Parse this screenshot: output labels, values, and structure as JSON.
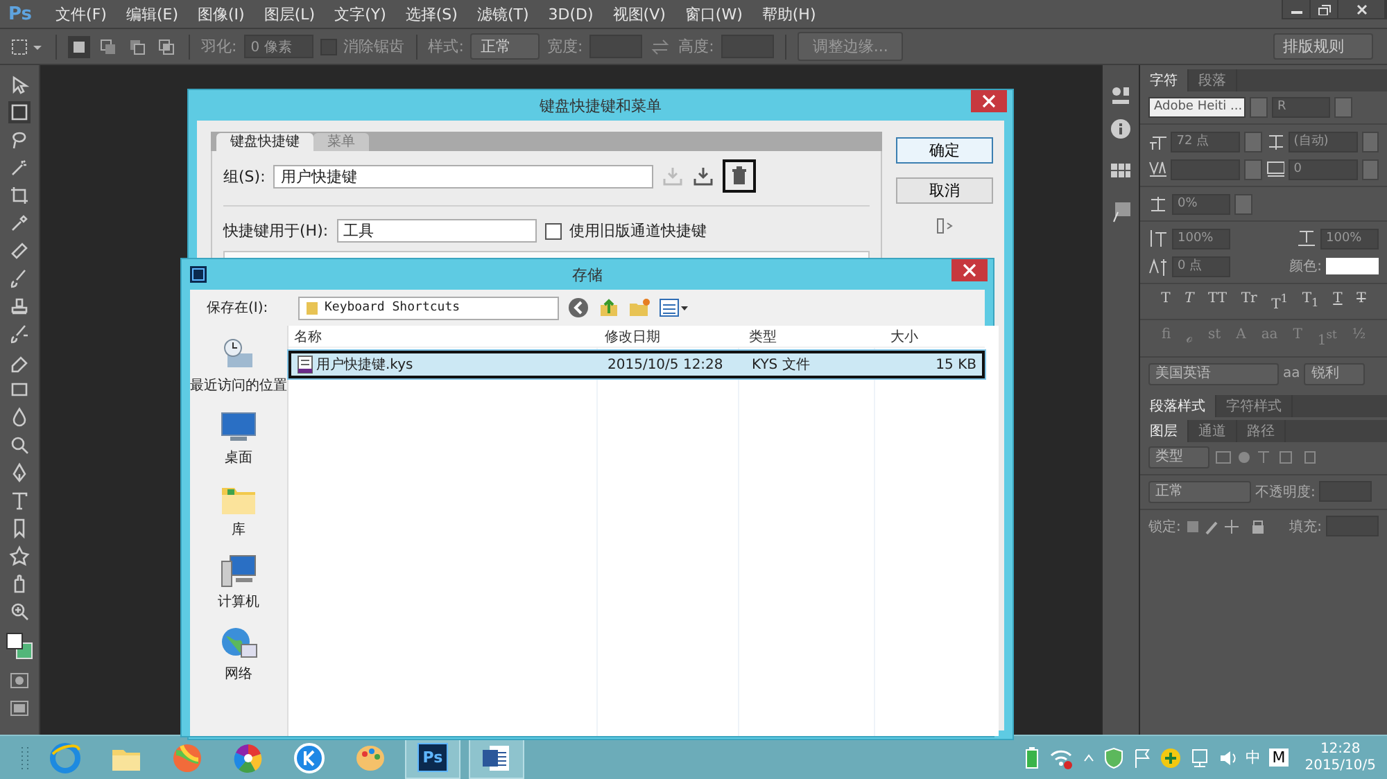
{
  "app_logo": "Ps",
  "menu": [
    "文件(F)",
    "编辑(E)",
    "图像(I)",
    "图层(L)",
    "文字(Y)",
    "选择(S)",
    "滤镜(T)",
    "3D(D)",
    "视图(V)",
    "窗口(W)",
    "帮助(H)"
  ],
  "options_bar": {
    "feather_label": "羽化:",
    "feather_value": "0 像素",
    "antialias": {
      "label": "消除锯齿",
      "checked": false
    },
    "style_label": "样式:",
    "style_value": "正常",
    "width_label": "宽度:",
    "height_label": "高度:",
    "refine_button": "调整边缘...",
    "workspace": "排版规则"
  },
  "shortcuts_dialog": {
    "title": "键盘快捷键和菜单",
    "tabs": [
      {
        "label": "键盘快捷键",
        "selected": true
      },
      {
        "label": "菜单",
        "selected": false
      }
    ],
    "set_label": "组(S):",
    "set_value": "用户快捷键",
    "delete_highlighted": true,
    "for_label": "快捷键用于(H):",
    "for_value": "工具",
    "legacy_checkbox": {
      "label": "使用旧版通道快捷键",
      "checked": false
    },
    "buttons": [
      {
        "label": "确定",
        "default": true
      },
      {
        "label": "取消",
        "default": false
      }
    ]
  },
  "save_dialog": {
    "title": "存储",
    "save_in_label": "保存在(I):",
    "save_in_value": "Keyboard Shortcuts",
    "places": [
      {
        "kind": "recent",
        "label": "最近访问的位置"
      },
      {
        "kind": "desktop",
        "label": "桌面"
      },
      {
        "kind": "library",
        "label": "库"
      },
      {
        "kind": "computer",
        "label": "计算机"
      },
      {
        "kind": "network",
        "label": "网络"
      }
    ],
    "columns": [
      "名称",
      "修改日期",
      "类型",
      "大小"
    ],
    "rows": [
      {
        "name": "用户快捷键.kys",
        "modified": "2015/10/5 12:28",
        "type": "KYS 文件",
        "size": "15 KB",
        "selected": true,
        "highlighted": true
      }
    ]
  },
  "character_panel": {
    "tabs": [
      {
        "label": "字符",
        "selected": true
      },
      {
        "label": "段落",
        "selected": false
      }
    ],
    "font": "Adobe Heiti ...",
    "font_style": "R",
    "size": "72 点",
    "leading": "(自动)",
    "tracking": "0",
    "vscale_shift": "0%",
    "vertical_scale": "100%",
    "horizontal_scale": "100%",
    "baseline": "0 点",
    "color_label": "颜色:",
    "style_buttons": [
      {
        "kind": "plain",
        "glyph": "T"
      },
      {
        "kind": "italic",
        "glyph": "T"
      },
      {
        "kind": "plain",
        "glyph": "TT"
      },
      {
        "kind": "plain",
        "glyph": "Tr"
      },
      {
        "kind": "plain",
        "glyph": "T$^{1}$"
      },
      {
        "kind": "plain",
        "glyph": "T$_{1}$"
      },
      {
        "kind": "underline",
        "glyph": "T"
      },
      {
        "kind": "strike",
        "glyph": "T"
      }
    ],
    "opentype_buttons": [
      "fi",
      "ℴ",
      "st",
      "A",
      "aa",
      "T",
      "1$^{st}$",
      "½"
    ],
    "language": "美国英语",
    "aa_label": "aa",
    "antialias": "锐利"
  },
  "styles_panel": {
    "tabs": [
      {
        "label": "段落样式",
        "selected": true
      },
      {
        "label": "字符样式",
        "selected": false
      }
    ]
  },
  "layers_panel": {
    "tabs": [
      {
        "label": "图层",
        "selected": true
      },
      {
        "label": "通道",
        "selected": false
      },
      {
        "label": "路径",
        "selected": false
      }
    ],
    "filter": "类型",
    "blend_mode": "正常",
    "opacity_label": "不透明度:",
    "lock_label": "锁定:",
    "fill_label": "填充:"
  },
  "taskbar": {
    "apps": [
      {
        "kind": "ie",
        "active": false
      },
      {
        "kind": "explorer",
        "active": false
      },
      {
        "kind": "ball",
        "active": false
      },
      {
        "kind": "pinwheel",
        "active": false
      },
      {
        "kind": "kcircle",
        "active": false
      },
      {
        "kind": "palette",
        "active": false
      },
      {
        "kind": "ps",
        "label": "Ps",
        "active": true
      },
      {
        "kind": "word",
        "active": true
      }
    ],
    "ime": "中",
    "ime_mode": "M",
    "time": "12:28",
    "date": "2015/10/5"
  }
}
